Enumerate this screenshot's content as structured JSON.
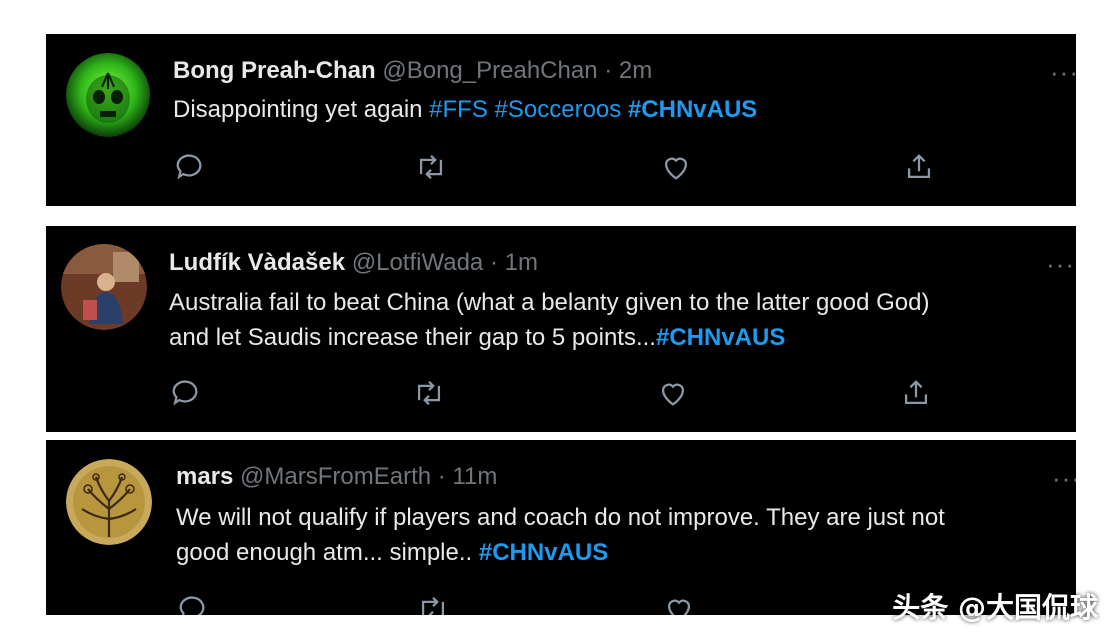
{
  "tweets": [
    {
      "name": "Bong Preah-Chan",
      "handle": "@Bong_PreahChan",
      "time": "2m",
      "text_plain": "Disappointing yet again ",
      "tags": [
        "#FFS",
        "#Socceroos",
        "#CHNvAUS"
      ],
      "avatar_icon": "green-skull-avatar"
    },
    {
      "name": "Ludfík Vàdašek",
      "handle": "@LotfiWada",
      "time": "1m",
      "line1": "Australia fail to beat China (what a belanty given to the latter good God)",
      "line2": "and let Saudis increase their gap to 5 points...",
      "tag": "#CHNvAUS",
      "avatar_icon": "person-photo-avatar"
    },
    {
      "name": "mars",
      "handle": "@MarsFromEarth",
      "time": "11m",
      "line1": "We will not qualify if players and coach do not improve. They are just not",
      "line2": "good enough atm... simple.. ",
      "tag": "#CHNvAUS",
      "avatar_icon": "tree-of-life-avatar"
    }
  ],
  "separator": "·",
  "more_label": "···",
  "actions": [
    "reply-icon",
    "retweet-icon",
    "like-icon",
    "share-icon"
  ],
  "watermark": "头条 @大国侃球",
  "colors": {
    "background": "#000000",
    "text": "#e7e9ea",
    "muted": "#71767b",
    "hashtag": "#1d9bf0"
  }
}
